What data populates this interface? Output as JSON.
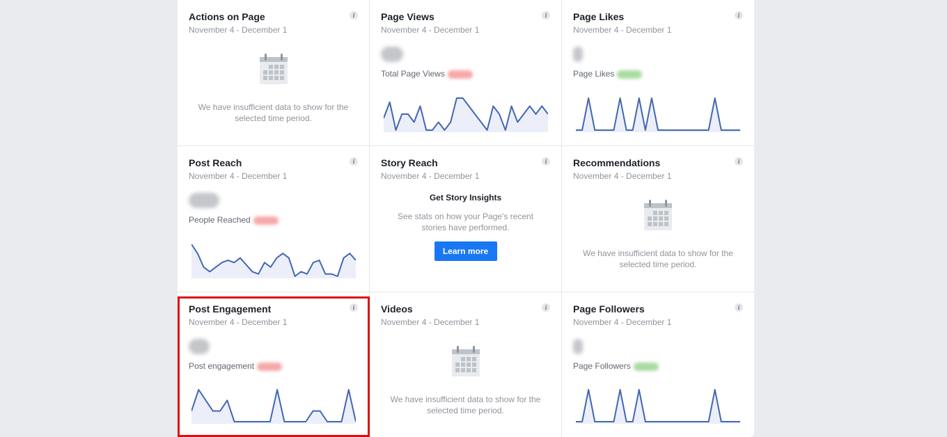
{
  "date_range": "November 4 - December 1",
  "insufficient_text": "We have insufficient data to show for the selected time period.",
  "info_glyph": "i",
  "colors": {
    "line": "#4267b2",
    "fill": "#eceff9",
    "highlight": "#e00d0d",
    "button": "#1877f2"
  },
  "cards": {
    "actions_on_page": {
      "title": "Actions on Page",
      "icon": "calendar-icon"
    },
    "page_views": {
      "title": "Page Views",
      "sub_label": "Total Page Views",
      "delta_color": "red",
      "chart_data": {
        "type": "line",
        "values": [
          4,
          8,
          1,
          5,
          5,
          3,
          7,
          1,
          1,
          3,
          1,
          3,
          9,
          9,
          7,
          5,
          3,
          1,
          7,
          5,
          1,
          7,
          3,
          5,
          7,
          5,
          7,
          5
        ]
      }
    },
    "page_likes": {
      "title": "Page Likes",
      "sub_label": "Page Likes",
      "delta_color": "green",
      "chart_data": {
        "type": "line",
        "values": [
          0,
          0,
          1,
          0,
          0,
          0,
          0,
          1,
          0,
          0,
          1,
          0,
          1,
          0,
          0,
          0,
          0,
          0,
          0,
          0,
          0,
          0,
          1,
          0,
          0,
          0,
          0
        ]
      }
    },
    "post_reach": {
      "title": "Post Reach",
      "sub_label": "People Reached",
      "delta_color": "red",
      "chart_data": {
        "type": "line",
        "values": [
          8,
          6,
          3,
          2,
          3,
          4,
          4.5,
          4,
          5,
          3.5,
          2,
          1.5,
          4,
          3,
          5,
          6,
          5,
          1,
          2,
          1.5,
          4,
          4.5,
          1.5,
          1.5,
          1,
          5,
          6,
          4.5
        ]
      }
    },
    "story_reach": {
      "title": "Story Reach",
      "heading": "Get Story Insights",
      "body": "See stats on how your Page's recent stories have performed.",
      "button_label": "Learn more"
    },
    "recommendations": {
      "title": "Recommendations",
      "icon": "calendar-icon"
    },
    "post_engagement": {
      "title": "Post Engagement",
      "sub_label": "Post engagement",
      "delta_color": "red",
      "highlighted": true,
      "chart_data": {
        "type": "line",
        "values": [
          1,
          3,
          2,
          1,
          1,
          2,
          0,
          0,
          0,
          0,
          0,
          0,
          3,
          0,
          0,
          0,
          0,
          1,
          1,
          0,
          0,
          0,
          3,
          0
        ]
      }
    },
    "videos": {
      "title": "Videos",
      "icon": "calendar-icon"
    },
    "page_followers": {
      "title": "Page Followers",
      "sub_label": "Page Followers",
      "delta_color": "green",
      "chart_data": {
        "type": "line",
        "values": [
          0,
          0,
          1,
          0,
          0,
          0,
          0,
          1,
          0,
          0,
          1,
          0,
          0,
          0,
          0,
          0,
          0,
          0,
          0,
          0,
          0,
          0,
          1,
          0,
          0,
          0,
          0
        ]
      }
    }
  }
}
